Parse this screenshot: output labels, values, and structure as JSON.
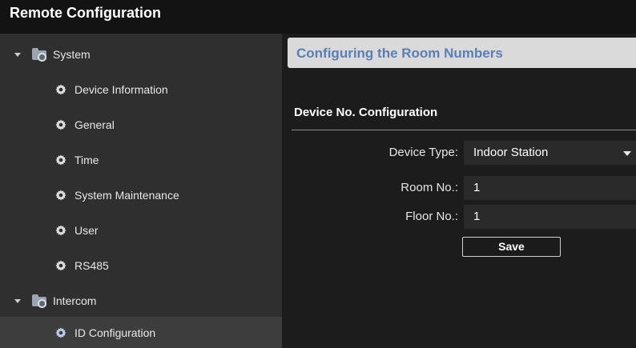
{
  "window": {
    "title": "Remote Configuration"
  },
  "sidebar": {
    "items": [
      {
        "label": "System",
        "kind": "parent",
        "icon": "folder-gear-icon"
      },
      {
        "label": "Device Information",
        "kind": "child",
        "icon": "gear-icon"
      },
      {
        "label": "General",
        "kind": "child",
        "icon": "gear-icon"
      },
      {
        "label": "Time",
        "kind": "child",
        "icon": "gear-icon"
      },
      {
        "label": "System Maintenance",
        "kind": "child",
        "icon": "gear-icon"
      },
      {
        "label": "User",
        "kind": "child",
        "icon": "gear-icon"
      },
      {
        "label": "RS485",
        "kind": "child",
        "icon": "gear-icon"
      },
      {
        "label": "Intercom",
        "kind": "parent",
        "icon": "folder-gear-icon"
      },
      {
        "label": "ID Configuration",
        "kind": "child",
        "icon": "gear-icon",
        "selected": true
      }
    ]
  },
  "main": {
    "header": "Configuring the Room Numbers",
    "section_title": "Device No. Configuration",
    "device_type": {
      "label": "Device Type:",
      "value": "Indoor Station"
    },
    "room_no": {
      "label": "Room No.:",
      "value": "1"
    },
    "floor_no": {
      "label": "Floor No.:",
      "value": "1"
    },
    "save_label": "Save"
  },
  "colors": {
    "header_text": "#5b7fb4",
    "sidebar_bg": "#2f2f2f",
    "main_bg": "#1c1c1c",
    "titlebar_bg": "#131313"
  }
}
